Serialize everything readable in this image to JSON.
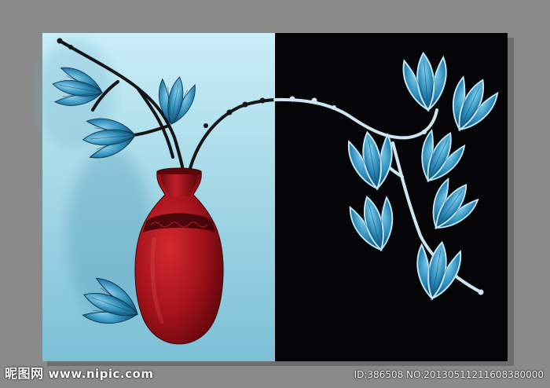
{
  "watermark": {
    "brand": "昵图网",
    "site": "www.nipic.com",
    "image_id": "ID:386508 NO:20130511211608380000"
  },
  "colors": {
    "background_gray": "#8a8a8a",
    "left_panel": "#b5e2ef",
    "right_panel": "#050508",
    "vase_red": "#b3141c",
    "petal_blue": "#2f8fb8",
    "stem": "#111111",
    "stem_light": "#cde6f0"
  }
}
